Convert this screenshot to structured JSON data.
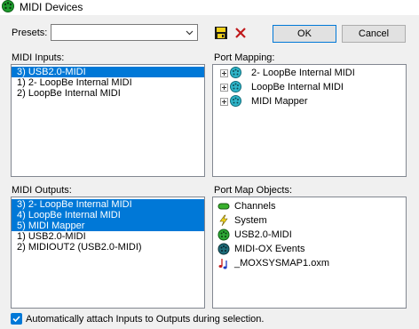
{
  "window": {
    "title": "MIDI Devices"
  },
  "presets": {
    "label": "Presets:",
    "value": ""
  },
  "buttons": {
    "ok": "OK",
    "cancel": "Cancel"
  },
  "midi_inputs": {
    "label": "MIDI Inputs:",
    "items": [
      {
        "text": "3) USB2.0-MIDI",
        "selected": true
      },
      {
        "text": "1) 2- LoopBe Internal MIDI",
        "selected": false
      },
      {
        "text": "2) LoopBe Internal MIDI",
        "selected": false
      }
    ]
  },
  "port_mapping": {
    "label": "Port Mapping:",
    "items": [
      {
        "text": "2- LoopBe Internal MIDI",
        "icon": "midi-port-icon"
      },
      {
        "text": "LoopBe Internal MIDI",
        "icon": "midi-port-icon"
      },
      {
        "text": "MIDI Mapper",
        "icon": "midi-port-icon"
      }
    ]
  },
  "midi_outputs": {
    "label": "MIDI Outputs:",
    "items": [
      {
        "text": "3) 2- LoopBe Internal MIDI",
        "selected": true
      },
      {
        "text": "4) LoopBe Internal MIDI",
        "selected": true
      },
      {
        "text": "5) MIDI Mapper",
        "selected": true
      },
      {
        "text": "1) USB2.0-MIDI",
        "selected": false
      },
      {
        "text": "2) MIDIOUT2 (USB2.0-MIDI)",
        "selected": false
      }
    ]
  },
  "port_map_objects": {
    "label": "Port Map Objects:",
    "items": [
      {
        "text": "Channels",
        "icon": "channels-icon"
      },
      {
        "text": "System",
        "icon": "system-lightning-icon"
      },
      {
        "text": "USB2.0-MIDI",
        "icon": "green-port-icon"
      },
      {
        "text": "MIDI-OX Events",
        "icon": "dark-port-icon"
      },
      {
        "text": "_MOXSYSMAP1.oxm",
        "icon": "music-note-icon"
      }
    ]
  },
  "auto_attach": {
    "label": "Automatically attach Inputs to Outputs during selection.",
    "checked": true
  },
  "colors": {
    "selection": "#0078d7",
    "window_bg": "#f0f0f0"
  }
}
